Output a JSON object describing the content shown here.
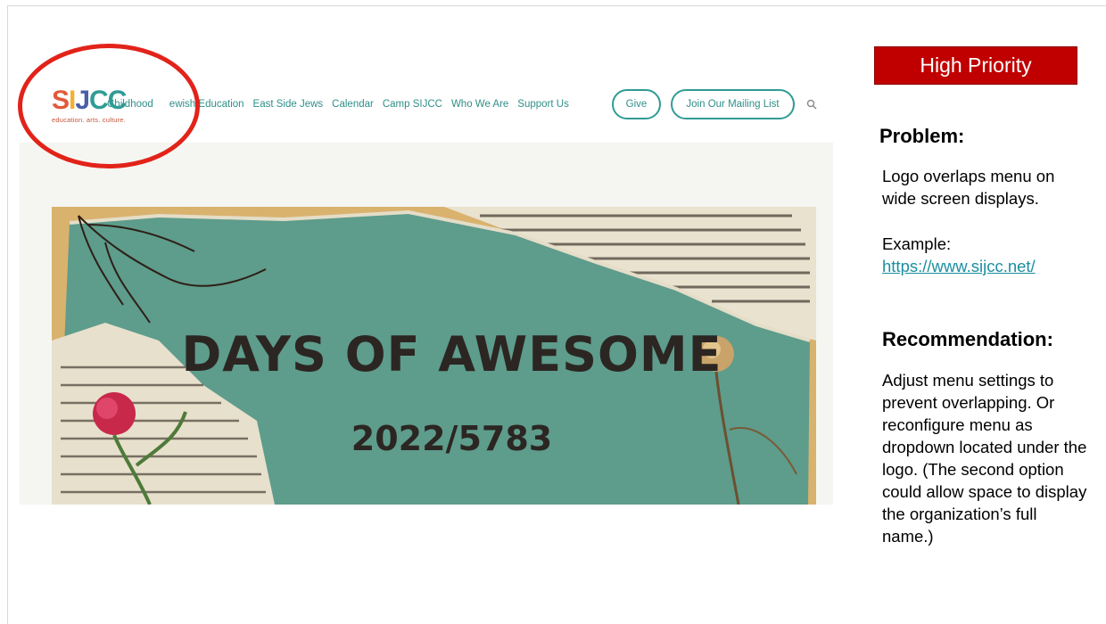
{
  "site": {
    "logo": {
      "letters": [
        "S",
        "I",
        "J",
        "C",
        "C"
      ],
      "letter_colors": [
        "#e05a3a",
        "#f2b134",
        "#4a5fa8",
        "#2f9c94",
        "#2f9c94"
      ],
      "tagline": "education. arts. culture."
    },
    "nav": {
      "items": [
        "Childhood",
        "ewish Education",
        "East Side Jews",
        "Calendar",
        "Camp SIJCC",
        "Who We Are",
        "Support Us"
      ],
      "give": "Give",
      "mailing": "Join Our Mailing List"
    },
    "banner": {
      "title": "DAYS OF AWESOME",
      "year": "2022/5783"
    }
  },
  "annotation": {
    "badge": "High Priority",
    "problem_heading": "Problem:",
    "problem_text": "Logo overlaps menu on wide screen displays.",
    "example_label": "Example:",
    "example_link": "https://www.sijcc.net/",
    "recommendation_heading": "Recommendation:",
    "recommendation_text": "Adjust menu settings to prevent overlapping. Or reconfigure menu as dropdown located under the logo. (The second option could allow space to display the organization’s full name.)"
  },
  "colors": {
    "accent_teal": "#2f9c94",
    "highlight_red": "#e2231a",
    "badge_red": "#c00000",
    "banner_teal": "#5e9c8c"
  }
}
